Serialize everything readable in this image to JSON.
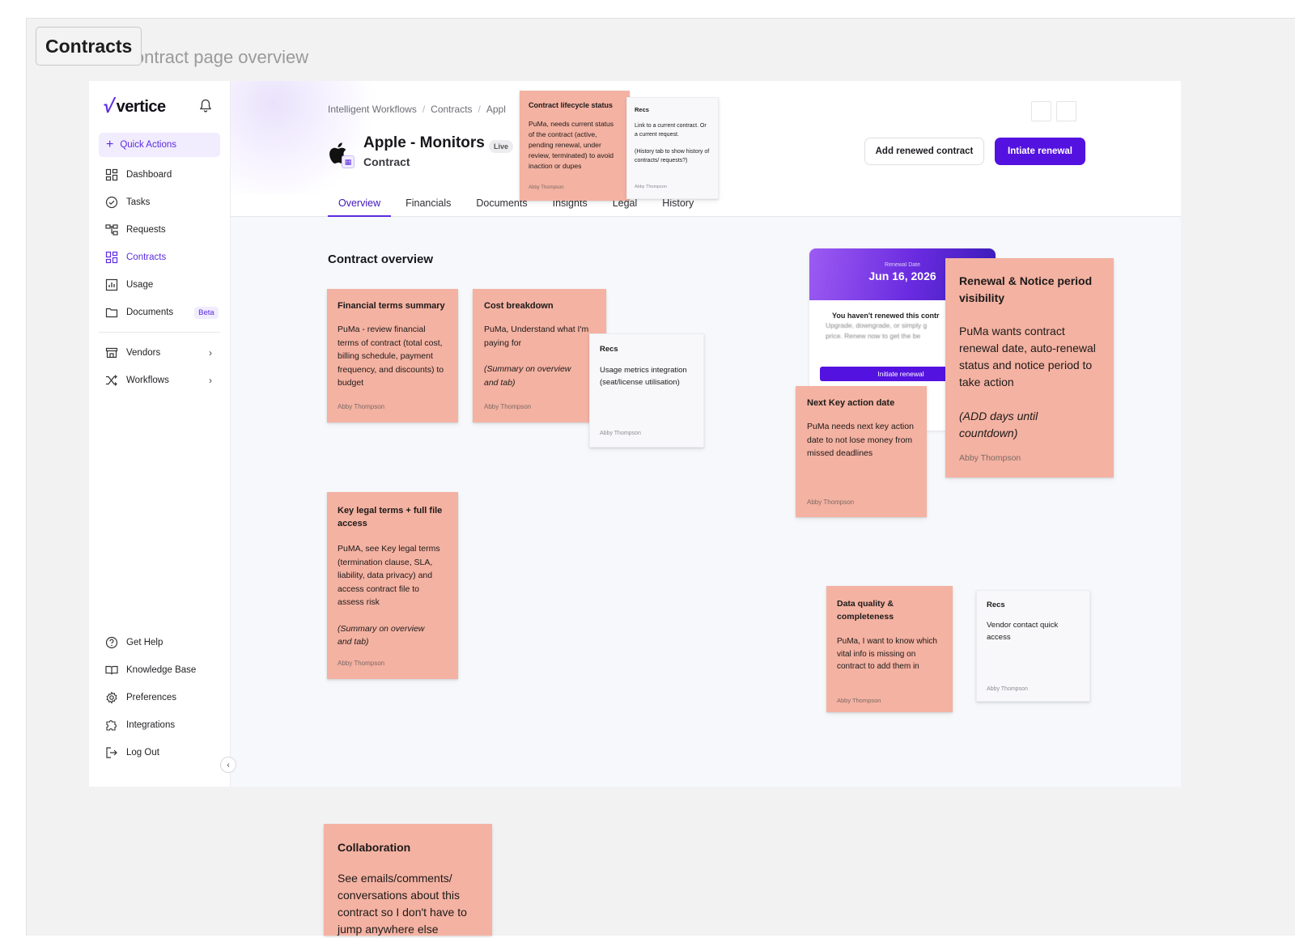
{
  "board": {
    "section_tag": "Contracts",
    "section_title": "Contract page overview"
  },
  "sidebar": {
    "brand": "vertice",
    "quick_actions": "Quick Actions",
    "items": [
      {
        "label": "Dashboard",
        "icon": "dashboard-icon"
      },
      {
        "label": "Tasks",
        "icon": "check-circle-icon"
      },
      {
        "label": "Requests",
        "icon": "requests-icon"
      },
      {
        "label": "Contracts",
        "icon": "contracts-icon",
        "active": true
      },
      {
        "label": "Usage",
        "icon": "bar-chart-icon"
      },
      {
        "label": "Documents",
        "icon": "folder-icon",
        "badge": "Beta"
      }
    ],
    "expandable": [
      {
        "label": "Vendors",
        "icon": "store-icon"
      },
      {
        "label": "Workflows",
        "icon": "shuffle-icon"
      }
    ],
    "bottom": [
      {
        "label": "Get Help",
        "icon": "help-icon"
      },
      {
        "label": "Knowledge Base",
        "icon": "book-icon"
      },
      {
        "label": "Preferences",
        "icon": "gear-icon"
      },
      {
        "label": "Integrations",
        "icon": "puzzle-icon"
      },
      {
        "label": "Log Out",
        "icon": "logout-icon"
      }
    ]
  },
  "header": {
    "breadcrumb": [
      "Intelligent Workflows",
      "Contracts",
      "Appl"
    ],
    "contract_name": "Apple - Monitors",
    "status": "Live",
    "contract_type": "Contract",
    "add_renewed_label": "Add renewed contract",
    "initiate_renewal_label": "Intiate renewal"
  },
  "tabs": [
    "Overview",
    "Financials",
    "Documents",
    "Insights",
    "Legal",
    "History"
  ],
  "main": {
    "section_title": "Contract overview"
  },
  "renewal_preview": {
    "label": "Renewal Date",
    "date": "Jun 16, 2026",
    "message": "You haven't renewed this contr",
    "sub_1": "Upgrade, downgrade, or simply g",
    "sub_2": "price. Renew now to get the be",
    "button": "Initiate renewal"
  },
  "stickies": {
    "lifecycle": {
      "title": "Contract lifecycle status",
      "body": "PuMa, needs current status of the contract (active, pending renewal, under review, terminated) to avoid inaction or dupes",
      "author": "Abby Thompson"
    },
    "recs_lifecycle": {
      "title": "Recs",
      "body_1": "Link to a current contract. Or a current request.",
      "body_2": "(History tab to show history of contracts/ requests?)",
      "author": "Abby Thompson"
    },
    "financial": {
      "title": "Financial terms summary",
      "body": "PuMa - review financial terms of contract (total cost, billing schedule, payment frequency, and discounts) to budget",
      "author": "Abby Thompson"
    },
    "cost": {
      "title": "Cost breakdown",
      "body": "PuMa, Understand what I'm paying for",
      "note": "(Summary on overview and tab)",
      "author": "Abby Thompson"
    },
    "recs_usage": {
      "title": "Recs",
      "body": "Usage metrics integration (seat/license utilisation)",
      "author": "Abby Thompson"
    },
    "legal": {
      "title": "Key legal terms + full file access",
      "body": "PuMA, see Key legal terms (termination clause, SLA, liability, data privacy) and access contract file to assess risk",
      "note": "(Summary on overview and tab)",
      "author": "Abby Thompson"
    },
    "next_action": {
      "title": "Next Key action date",
      "body": "PuMa needs next key action date to not lose money from missed deadlines",
      "author": "Abby Thompson"
    },
    "renewal_notice": {
      "title": "Renewal & Notice period visibility",
      "body": "PuMa wants contract renewal date, auto-renewal status and notice period to take action",
      "note": "(ADD days until countdown)",
      "author": "Abby Thompson"
    },
    "data_quality": {
      "title": "Data quality & completeness",
      "body": "PuMa, I want to know which vital info is missing on contract to add them in",
      "author": "Abby Thompson"
    },
    "recs_vendor": {
      "title": "Recs",
      "body": "Vendor contact quick access",
      "author": "Abby Thompson"
    },
    "collaboration": {
      "title": "Collaboration",
      "body": "See emails/comments/ conversations about this contract so I don't have to jump anywhere else"
    }
  },
  "colors": {
    "accent": "#5b2be0",
    "primary_button": "#5412e0",
    "sticky_salmon": "#f4b2a2",
    "sticky_white": "#f8f8fa"
  }
}
